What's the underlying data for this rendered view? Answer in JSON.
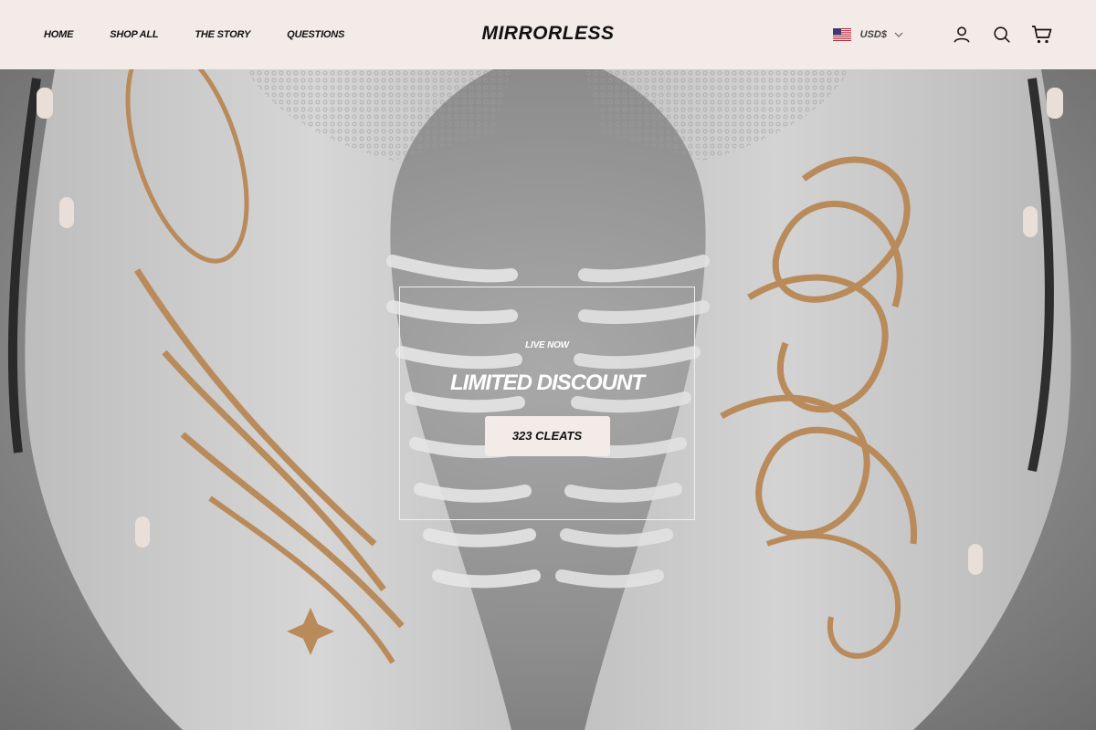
{
  "header": {
    "nav": [
      "HOME",
      "SHOP ALL",
      "THE STORY",
      "QUESTIONS"
    ],
    "logo": "MIRRORLESS",
    "currency": "USD$",
    "icons": [
      "account-icon",
      "search-icon",
      "cart-icon"
    ]
  },
  "hero": {
    "kicker": "LIVE NOW",
    "headline": "LIMITED DISCOUNT",
    "cta_label": "323 CLEATS"
  },
  "colors": {
    "header_bg": "#f2ebe7",
    "accent_gold": "#b98a5a",
    "button_bg": "#f2ebe7",
    "text_dark": "#111111"
  }
}
